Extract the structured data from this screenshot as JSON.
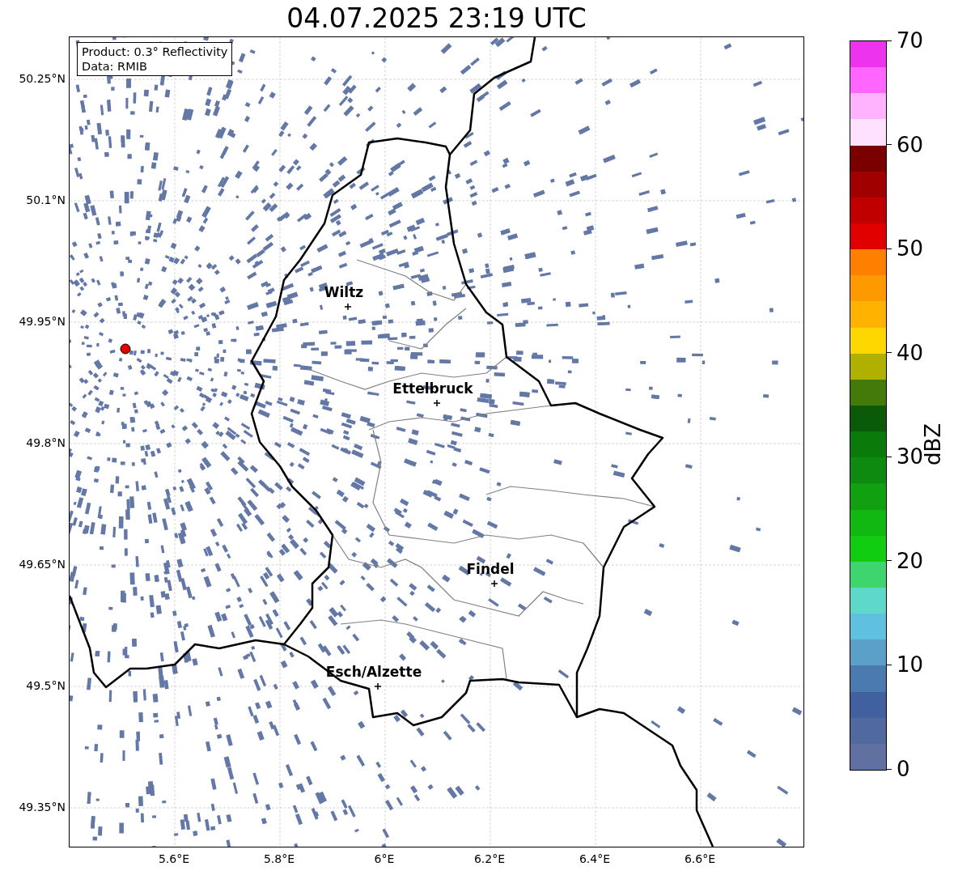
{
  "title": "04.07.2025 23:19 UTC",
  "info_box": [
    "Product: 0.3° Reflectivity",
    "Data: RMIB"
  ],
  "lat_ticks": [
    "50.25°N",
    "50.1°N",
    "49.95°N",
    "49.8°N",
    "49.65°N",
    "49.5°N",
    "49.35°N"
  ],
  "lon_ticks": [
    "5.6°E",
    "5.8°E",
    "6°E",
    "6.2°E",
    "6.4°E",
    "6.6°E"
  ],
  "cities": [
    {
      "name": "Wiltz"
    },
    {
      "name": "Ettelbruck"
    },
    {
      "name": "Findel"
    },
    {
      "name": "Esch/Alzette"
    }
  ],
  "colorbar": {
    "label": "dBZ",
    "ticks": [
      "70",
      "60",
      "50",
      "40",
      "30",
      "20",
      "10",
      "0"
    ],
    "bands": [
      {
        "color": "#ee33ee"
      },
      {
        "color": "#ff66ff"
      },
      {
        "color": "#ffb3ff"
      },
      {
        "color": "#ffe0ff"
      },
      {
        "color": "#7a0000"
      },
      {
        "color": "#a00000"
      },
      {
        "color": "#c00000"
      },
      {
        "color": "#e00000"
      },
      {
        "color": "#ff7f00"
      },
      {
        "color": "#ff9900"
      },
      {
        "color": "#ffb300"
      },
      {
        "color": "#ffd700"
      },
      {
        "color": "#b0b000"
      },
      {
        "color": "#447a0a"
      },
      {
        "color": "#0a5a0a"
      },
      {
        "color": "#0a7a0a"
      },
      {
        "color": "#0e8a10"
      },
      {
        "color": "#10a010"
      },
      {
        "color": "#12b812"
      },
      {
        "color": "#12cc12"
      },
      {
        "color": "#3ed46e"
      },
      {
        "color": "#5ed8c8"
      },
      {
        "color": "#60c0e0"
      },
      {
        "color": "#5aa0c8"
      },
      {
        "color": "#4a7ab0"
      },
      {
        "color": "#4060a0"
      },
      {
        "color": "#506aa0"
      },
      {
        "color": "#6070a0"
      }
    ]
  }
}
